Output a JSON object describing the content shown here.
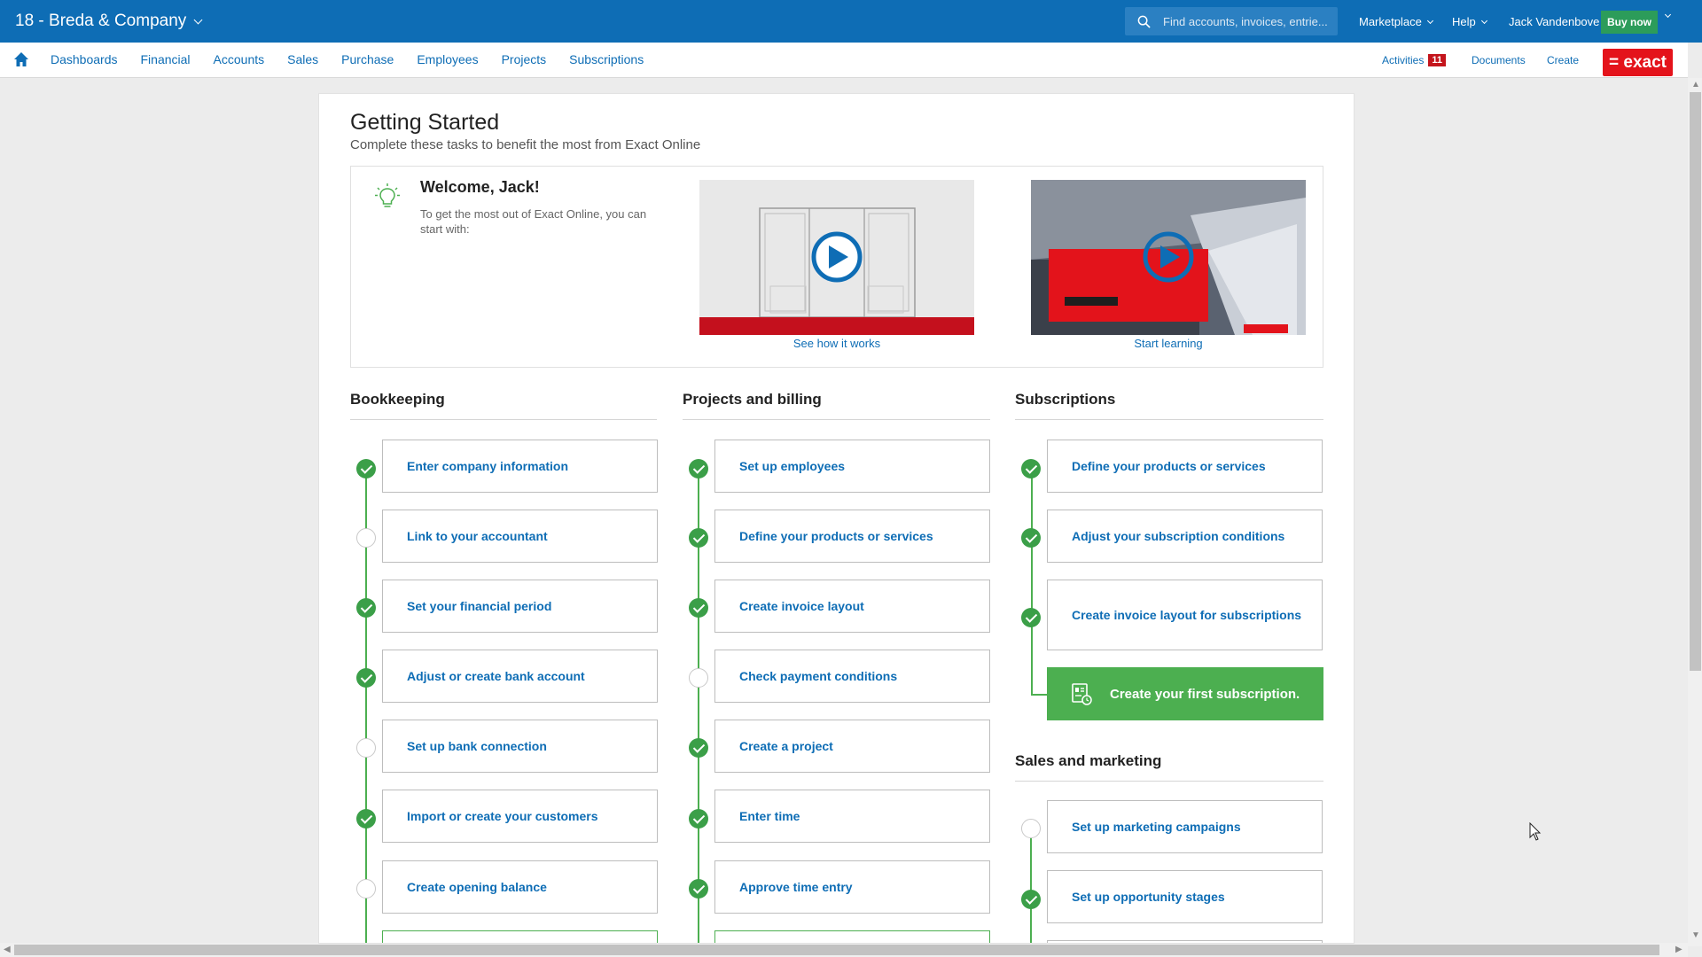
{
  "header": {
    "company": "18 - Breda & Company",
    "search_placeholder": "Find accounts, invoices, entrie...",
    "marketplace": "Marketplace",
    "help": "Help",
    "user": "Jack Vandenbove",
    "buy_now": "Buy now"
  },
  "nav": {
    "items": [
      "Dashboards",
      "Financial",
      "Accounts",
      "Sales",
      "Purchase",
      "Employees",
      "Projects",
      "Subscriptions"
    ],
    "activities": "Activities",
    "activities_count": "11",
    "documents": "Documents",
    "create": "Create",
    "logo": "= exact"
  },
  "page": {
    "title": "Getting Started",
    "subtitle": "Complete these tasks to benefit the most from Exact Online"
  },
  "welcome": {
    "title": "Welcome, Jack!",
    "text": "To get the most out of Exact Online, you can start with:",
    "video1_link": "See how it works",
    "video2_link": "Start learning"
  },
  "bookkeeping": {
    "title": "Bookkeeping",
    "steps": [
      {
        "label": "Enter company information",
        "done": true
      },
      {
        "label": "Link to your accountant",
        "done": false
      },
      {
        "label": "Set your financial period",
        "done": true
      },
      {
        "label": "Adjust or create bank account",
        "done": true
      },
      {
        "label": "Set up bank connection",
        "done": false
      },
      {
        "label": "Import or create your customers",
        "done": true
      },
      {
        "label": "Create opening balance",
        "done": false
      }
    ]
  },
  "projects": {
    "title": "Projects and billing",
    "steps": [
      {
        "label": "Set up employees",
        "done": true
      },
      {
        "label": "Define your products or services",
        "done": true
      },
      {
        "label": "Create invoice layout",
        "done": true
      },
      {
        "label": "Check payment conditions",
        "done": false
      },
      {
        "label": "Create a project",
        "done": true
      },
      {
        "label": "Enter time",
        "done": true
      },
      {
        "label": "Approve time entry",
        "done": true
      }
    ]
  },
  "subscriptions": {
    "title": "Subscriptions",
    "steps": [
      {
        "label": "Define your products or services",
        "done": true
      },
      {
        "label": "Adjust your subscription conditions",
        "done": true
      },
      {
        "label": "Create invoice layout for subscriptions",
        "done": true
      }
    ],
    "cta": "Create your first subscription."
  },
  "sales": {
    "title": "Sales and marketing",
    "steps": [
      {
        "label": "Set up marketing campaigns",
        "done": false
      },
      {
        "label": "Set up opportunity stages",
        "done": true
      }
    ]
  }
}
